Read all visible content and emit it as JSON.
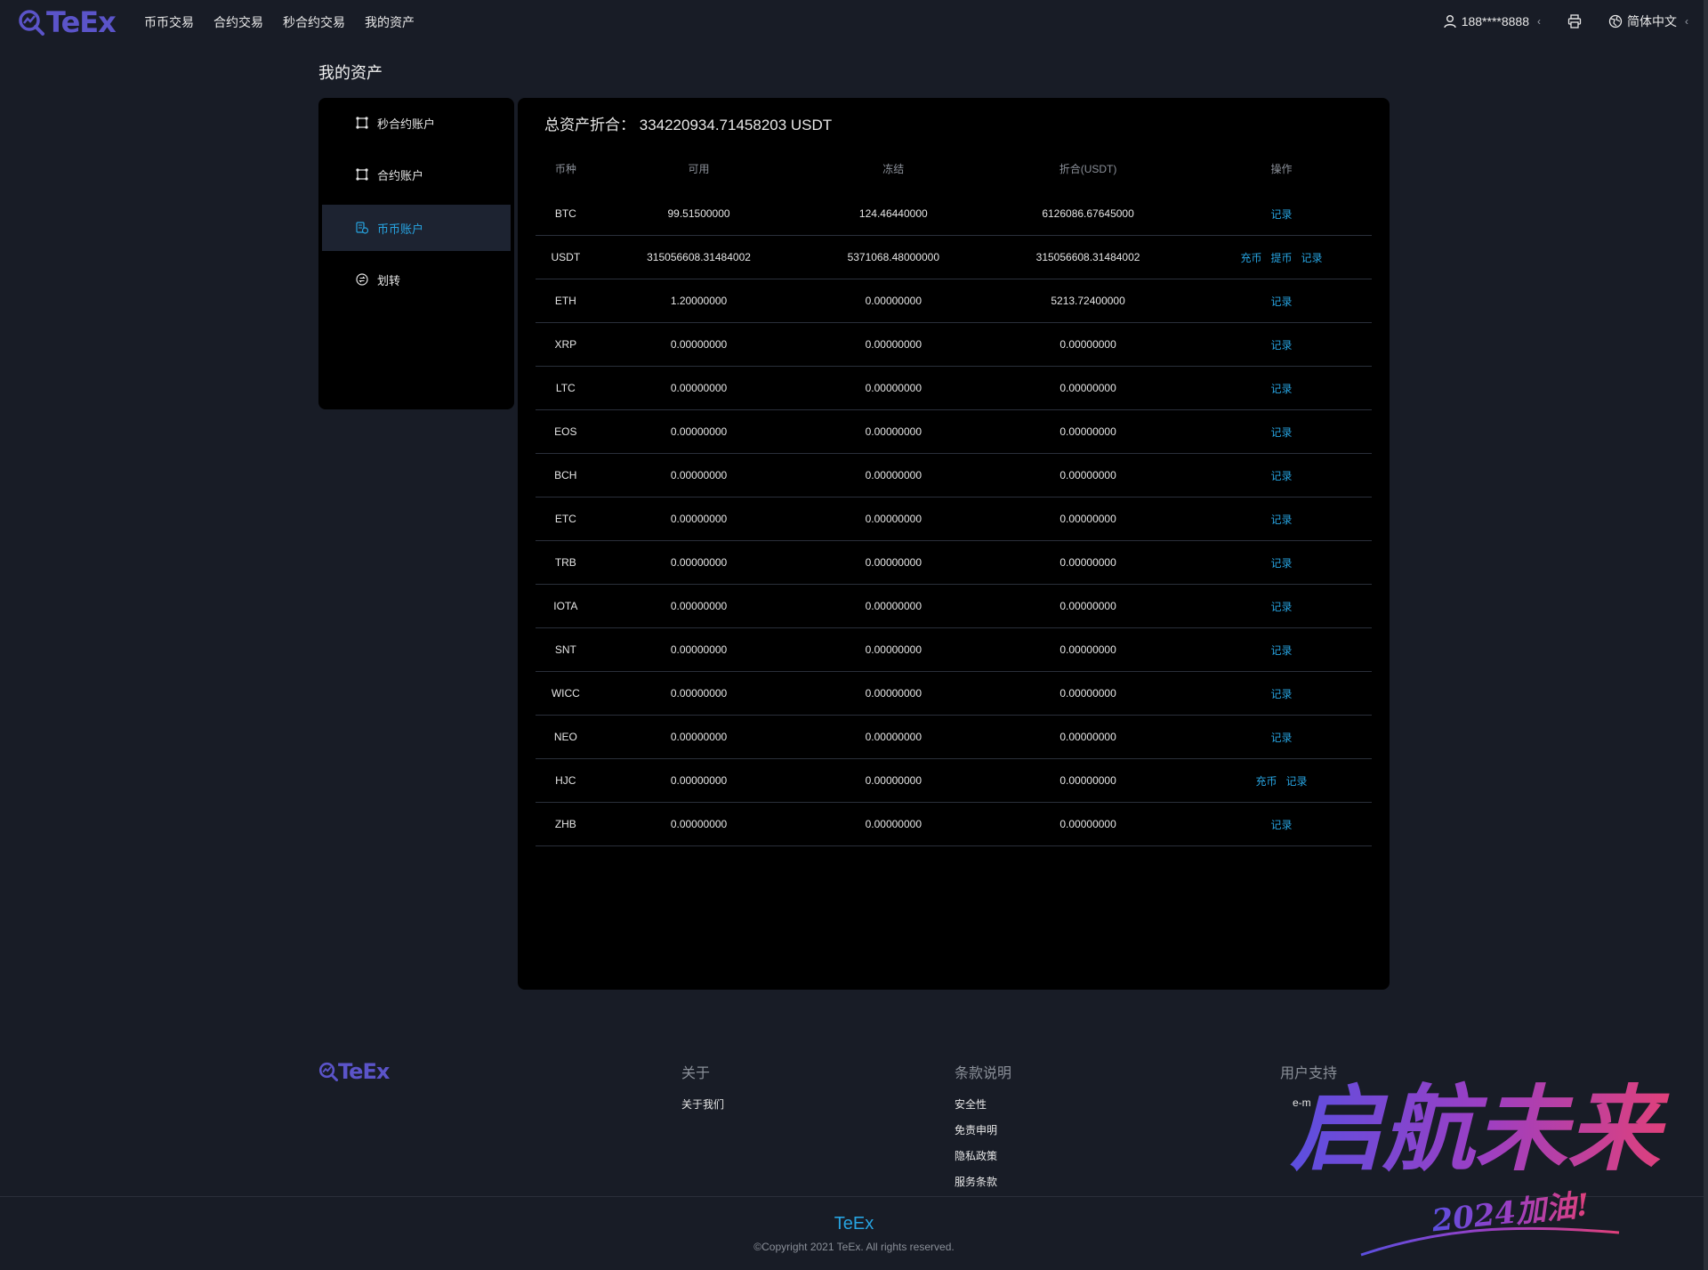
{
  "header": {
    "logo_text": "TeEx",
    "nav": [
      "币币交易",
      "合约交易",
      "秒合约交易",
      "我的资产"
    ],
    "user": "188****8888",
    "language": "简体中文"
  },
  "page": {
    "title": "我的资产"
  },
  "sidebar": {
    "items": [
      {
        "label": "秒合约账户",
        "icon": "grid-icon"
      },
      {
        "label": "合约账户",
        "icon": "grid-icon"
      },
      {
        "label": "币币账户",
        "icon": "coins-icon",
        "active": true
      },
      {
        "label": "划转",
        "icon": "transfer-icon"
      }
    ]
  },
  "assets": {
    "total_label": "总资产折合：",
    "total_value": "334220934.71458203 USDT",
    "columns": [
      "币种",
      "可用",
      "冻结",
      "折合(USDT)",
      "操作"
    ],
    "rows": [
      {
        "coin": "BTC",
        "available": "99.51500000",
        "frozen": "124.46440000",
        "usdt": "6126086.67645000",
        "ops": [
          "记录"
        ]
      },
      {
        "coin": "USDT",
        "available": "315056608.31484002",
        "frozen": "5371068.48000000",
        "usdt": "315056608.31484002",
        "ops": [
          "充币",
          "提币",
          "记录"
        ]
      },
      {
        "coin": "ETH",
        "available": "1.20000000",
        "frozen": "0.00000000",
        "usdt": "5213.72400000",
        "ops": [
          "记录"
        ]
      },
      {
        "coin": "XRP",
        "available": "0.00000000",
        "frozen": "0.00000000",
        "usdt": "0.00000000",
        "ops": [
          "记录"
        ]
      },
      {
        "coin": "LTC",
        "available": "0.00000000",
        "frozen": "0.00000000",
        "usdt": "0.00000000",
        "ops": [
          "记录"
        ]
      },
      {
        "coin": "EOS",
        "available": "0.00000000",
        "frozen": "0.00000000",
        "usdt": "0.00000000",
        "ops": [
          "记录"
        ]
      },
      {
        "coin": "BCH",
        "available": "0.00000000",
        "frozen": "0.00000000",
        "usdt": "0.00000000",
        "ops": [
          "记录"
        ]
      },
      {
        "coin": "ETC",
        "available": "0.00000000",
        "frozen": "0.00000000",
        "usdt": "0.00000000",
        "ops": [
          "记录"
        ]
      },
      {
        "coin": "TRB",
        "available": "0.00000000",
        "frozen": "0.00000000",
        "usdt": "0.00000000",
        "ops": [
          "记录"
        ]
      },
      {
        "coin": "IOTA",
        "available": "0.00000000",
        "frozen": "0.00000000",
        "usdt": "0.00000000",
        "ops": [
          "记录"
        ]
      },
      {
        "coin": "SNT",
        "available": "0.00000000",
        "frozen": "0.00000000",
        "usdt": "0.00000000",
        "ops": [
          "记录"
        ]
      },
      {
        "coin": "WICC",
        "available": "0.00000000",
        "frozen": "0.00000000",
        "usdt": "0.00000000",
        "ops": [
          "记录"
        ]
      },
      {
        "coin": "NEO",
        "available": "0.00000000",
        "frozen": "0.00000000",
        "usdt": "0.00000000",
        "ops": [
          "记录"
        ]
      },
      {
        "coin": "HJC",
        "available": "0.00000000",
        "frozen": "0.00000000",
        "usdt": "0.00000000",
        "ops": [
          "充币",
          "记录"
        ]
      },
      {
        "coin": "ZHB",
        "available": "0.00000000",
        "frozen": "0.00000000",
        "usdt": "0.00000000",
        "ops": [
          "记录"
        ]
      }
    ]
  },
  "footer": {
    "logo_text": "TeEx",
    "about": {
      "heading": "关于",
      "links": [
        "关于我们"
      ]
    },
    "terms": {
      "heading": "条款说明",
      "links": [
        "安全性",
        "免责申明",
        "隐私政策",
        "服务条款"
      ]
    },
    "support": {
      "heading": "用户支持",
      "links": [
        "e-m"
      ]
    },
    "brand": "TeEx",
    "copyright": "©Copyright 2021 TeEx. All rights reserved."
  },
  "overlay": {
    "title": "启航未来",
    "subtitle": "2024加油!"
  },
  "colors": {
    "background": "#181c26",
    "panel": "#000000",
    "accent": "#27a3e0",
    "logo": "#5b54c9"
  }
}
